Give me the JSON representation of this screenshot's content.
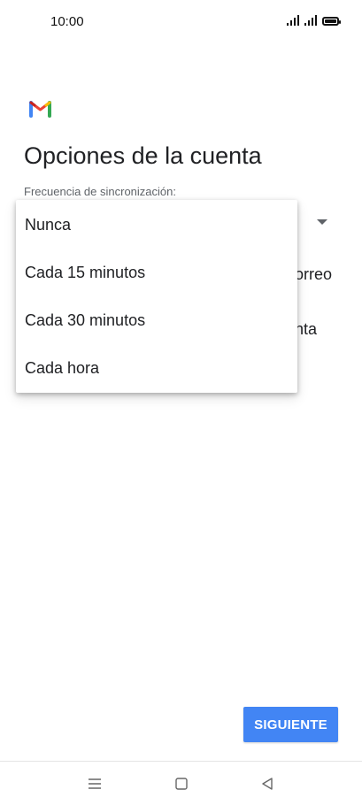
{
  "status_bar": {
    "time": "10:00",
    "icons": [
      "signal-icon",
      "signal-icon",
      "battery-icon"
    ]
  },
  "app": {
    "logo_icon": "gmail-logo-icon",
    "colors": {
      "blue": "#4285f4",
      "red": "#ea4335",
      "yellow": "#fbbc04",
      "green": "#34a853"
    }
  },
  "page": {
    "title": "Opciones de la cuenta",
    "sync_label": "Frecuencia de sincronización:",
    "background_text_1": "orreo",
    "background_text_2": "nta"
  },
  "dropdown": {
    "options": [
      "Nunca",
      "Cada 15 minutos",
      "Cada 30 minutos",
      "Cada hora"
    ]
  },
  "actions": {
    "next_label": "SIGUIENTE",
    "next_color": "#4285f4"
  },
  "nav_bar": {
    "icons": [
      "menu-icon",
      "home-icon",
      "back-icon"
    ]
  }
}
